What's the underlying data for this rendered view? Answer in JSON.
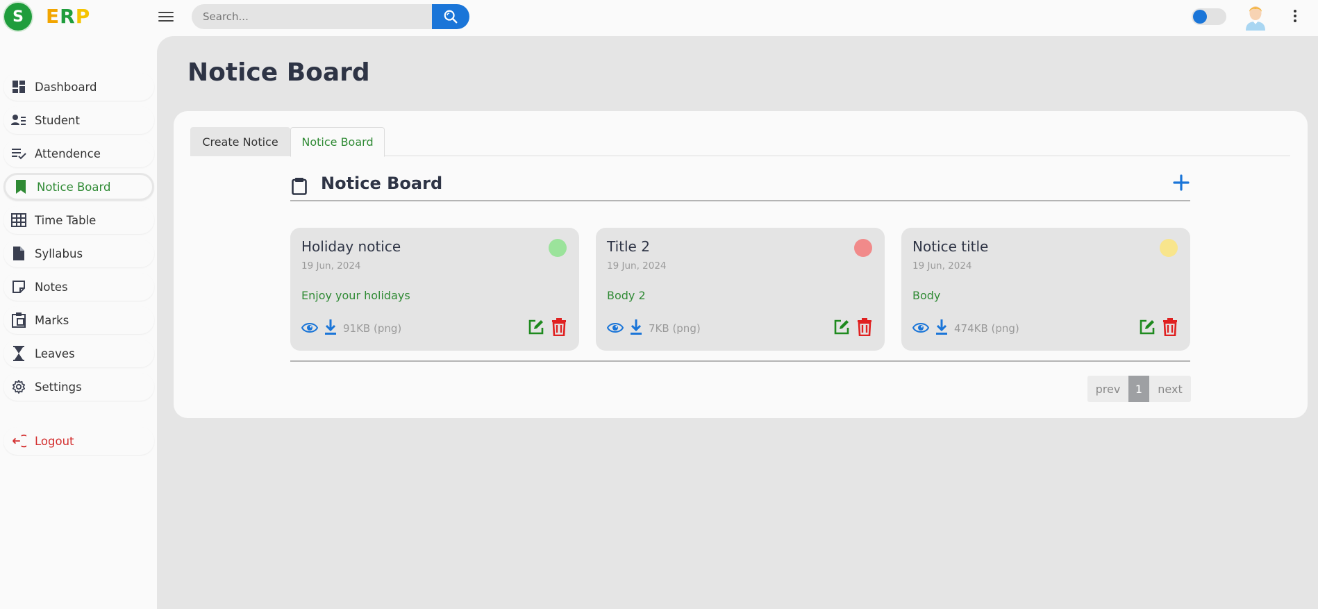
{
  "brand": {
    "logo_letter": "S",
    "name_e": "E",
    "name_r": "R",
    "name_p": "P"
  },
  "search": {
    "placeholder": "Search..."
  },
  "sidebar": {
    "items": [
      {
        "label": "Dashboard"
      },
      {
        "label": "Student"
      },
      {
        "label": "Attendence"
      },
      {
        "label": "Notice Board"
      },
      {
        "label": "Time Table"
      },
      {
        "label": "Syllabus"
      },
      {
        "label": "Notes"
      },
      {
        "label": "Marks"
      },
      {
        "label": "Leaves"
      },
      {
        "label": "Settings"
      }
    ],
    "logout": "Logout",
    "active": "Notice Board"
  },
  "page": {
    "title": "Notice Board"
  },
  "tabs": [
    {
      "label": "Create Notice"
    },
    {
      "label": "Notice Board"
    }
  ],
  "board": {
    "title": "Notice Board"
  },
  "notices": [
    {
      "title": "Holiday notice",
      "date": "19 Jun, 2024",
      "body": "Enjoy your holidays",
      "size": "91KB (png)",
      "dot_color": "#9be39b"
    },
    {
      "title": "Title 2",
      "date": "19 Jun, 2024",
      "body": "Body 2",
      "size": "7KB (png)",
      "dot_color": "#f18a8a"
    },
    {
      "title": "Notice title",
      "date": "19 Jun, 2024",
      "body": "Body",
      "size": "474KB (png)",
      "dot_color": "#f8e58c"
    }
  ],
  "pagination": {
    "prev": "prev",
    "current": "1",
    "next": "next"
  },
  "colors": {
    "accent": "#1a75d8",
    "active_green": "#2f8a34",
    "danger": "#d32f2f"
  }
}
